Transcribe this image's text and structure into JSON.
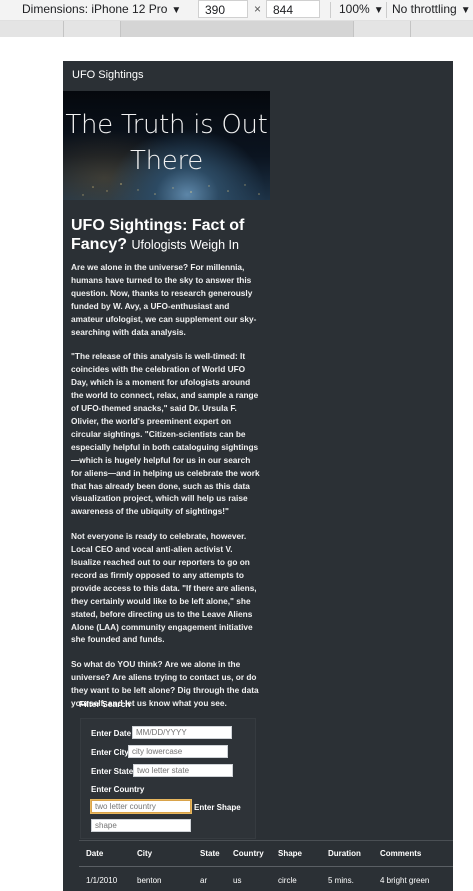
{
  "devtools": {
    "dimensions_label": "Dimensions: iPhone 12 Pro",
    "width": "390",
    "height": "844",
    "zoom": "100%",
    "throttling": "No throttling"
  },
  "nav": {
    "brand": "UFO Sightings"
  },
  "hero": {
    "title": "The Truth is Out There"
  },
  "article": {
    "headline": "UFO Sightings: Fact of Fancy?",
    "subheadline": "Ufologists Weigh In",
    "paragraphs": [
      "Are we alone in the universe? For millennia, humans have turned to the sky to answer this question. Now, thanks to research generously funded by W. Avy, a UFO-enthusiast and amateur ufologist, we can supplement our sky-searching with data analysis.",
      "\"The release of this analysis is well-timed: It coincides with the celebration of World UFO Day, which is a moment for ufologists around the world to connect, relax, and sample a range of UFO-themed snacks,\" said Dr. Ursula F. Olivier, the world's preeminent expert on circular sightings. \"Citizen-scientists can be especially helpful in both cataloguing sightings—which is hugely helpful for us in our search for aliens—and in helping us celebrate the work that has already been done, such as this data visualization project, which will help us raise awareness of the ubiquity of sightings!\"",
      "Not everyone is ready to celebrate, however. Local CEO and vocal anti-alien activist V. Isualize reached out to our reporters to go on record as firmly opposed to any attempts to provide access to this data. \"If there are aliens, they certainly would like to be left alone,\" she stated, before directing us to the Leave Aliens Alone (LAA) community engagement initiative she founded and funds.",
      "So what do YOU think? Are we alone in the universe? Are aliens trying to contact us, or do they want to be left alone? Dig through the data yourself, and let us know what you see."
    ]
  },
  "filters": {
    "heading": "Filter Search",
    "date": {
      "label": "Enter Date",
      "placeholder": "MM/DD/YYYY"
    },
    "city": {
      "label": "Enter City",
      "placeholder": "city lowercase"
    },
    "state": {
      "label": "Enter State",
      "placeholder": "two letter state"
    },
    "country": {
      "label": "Enter Country",
      "placeholder": "two letter country"
    },
    "shape": {
      "label": "Enter Shape",
      "placeholder": "shape"
    }
  },
  "table": {
    "headers": [
      "Date",
      "City",
      "State",
      "Country",
      "Shape",
      "Duration",
      "Comments"
    ],
    "rows": [
      [
        "1/1/2010",
        "benton",
        "ar",
        "us",
        "circle",
        "5 mins.",
        "4 bright green"
      ]
    ]
  },
  "colors": {
    "page_bg": "#2b3035",
    "accent_focus": "#e8b860"
  }
}
